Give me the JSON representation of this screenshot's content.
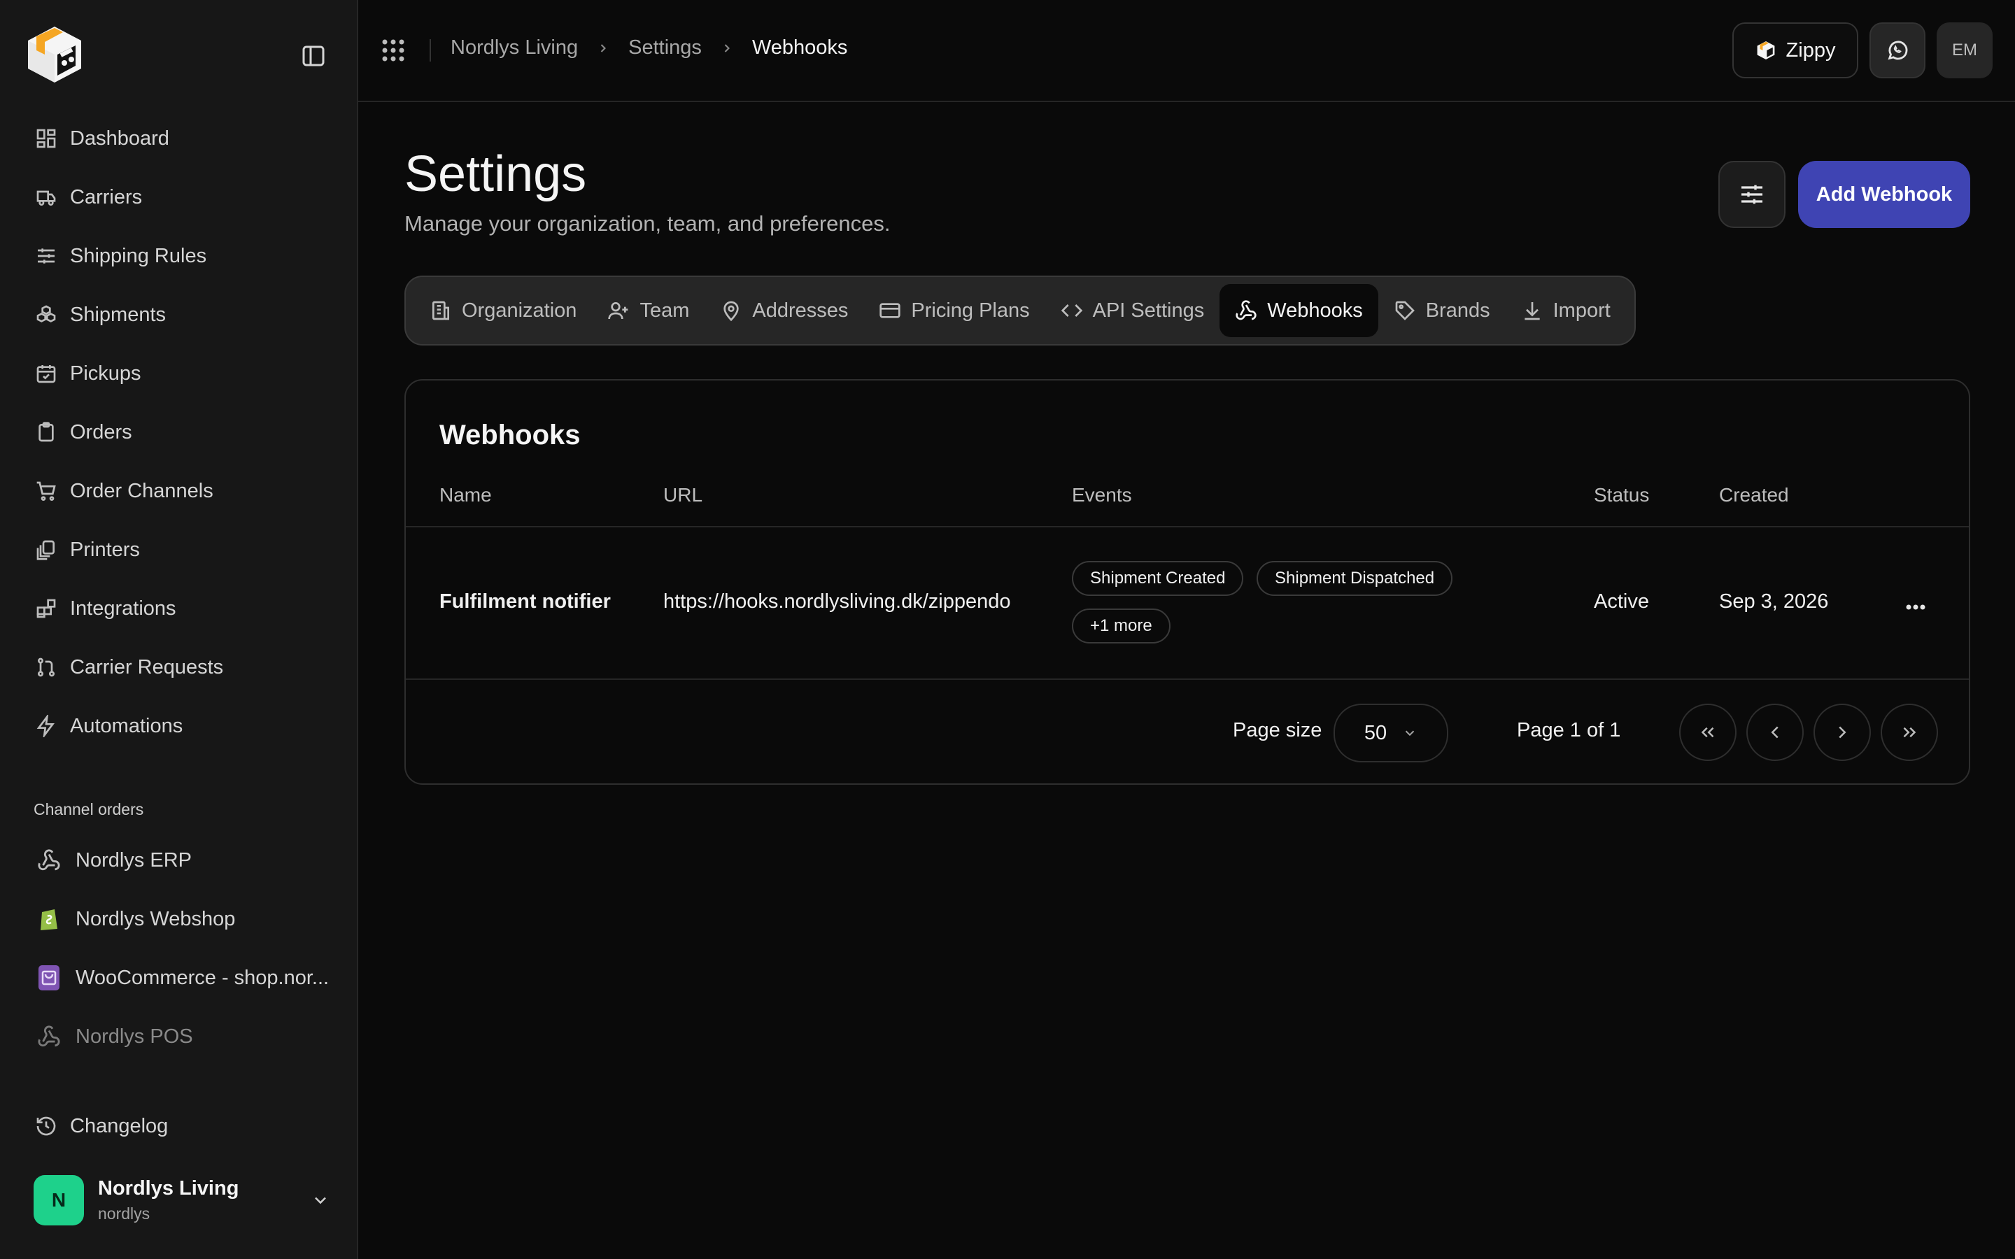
{
  "sidebar": {
    "nav": [
      {
        "label": "Dashboard",
        "icon": "dashboard-icon"
      },
      {
        "label": "Carriers",
        "icon": "truck-icon"
      },
      {
        "label": "Shipping Rules",
        "icon": "sliders-icon"
      },
      {
        "label": "Shipments",
        "icon": "boxes-icon"
      },
      {
        "label": "Pickups",
        "icon": "calendar-check-icon"
      },
      {
        "label": "Orders",
        "icon": "clipboard-icon"
      },
      {
        "label": "Order Channels",
        "icon": "cart-icon"
      },
      {
        "label": "Printers",
        "icon": "printer-icon"
      },
      {
        "label": "Integrations",
        "icon": "blocks-icon"
      },
      {
        "label": "Carrier Requests",
        "icon": "git-pull-icon"
      },
      {
        "label": "Automations",
        "icon": "zap-icon"
      }
    ],
    "channels_title": "Channel orders",
    "channels": [
      {
        "label": "Nordlys ERP",
        "icon": "webhook-icon"
      },
      {
        "label": "Nordlys Webshop",
        "icon": "shopify-icon"
      },
      {
        "label": "WooCommerce - shop.nor...",
        "icon": "woocommerce-icon"
      },
      {
        "label": "Nordlys POS",
        "icon": "webhook-icon"
      }
    ],
    "changelog": "Changelog",
    "org": {
      "initial": "N",
      "name": "Nordlys Living",
      "slug": "nordlys"
    }
  },
  "topbar": {
    "breadcrumb": [
      "Nordlys Living",
      "Settings",
      "Webhooks"
    ],
    "zippy_label": "Zippy",
    "user_initials": "EM"
  },
  "page": {
    "title": "Settings",
    "subtitle": "Manage your organization, team, and preferences.",
    "add_button": "Add Webhook"
  },
  "tabs": [
    {
      "label": "Organization",
      "icon": "building-icon"
    },
    {
      "label": "Team",
      "icon": "user-plus-icon"
    },
    {
      "label": "Addresses",
      "icon": "map-pin-icon"
    },
    {
      "label": "Pricing Plans",
      "icon": "credit-card-icon"
    },
    {
      "label": "API Settings",
      "icon": "code-icon"
    },
    {
      "label": "Webhooks",
      "icon": "webhook-icon",
      "active": true
    },
    {
      "label": "Brands",
      "icon": "tag-icon"
    },
    {
      "label": "Import",
      "icon": "download-icon"
    }
  ],
  "table": {
    "title": "Webhooks",
    "columns": [
      "Name",
      "URL",
      "Events",
      "Status",
      "Created"
    ],
    "rows": [
      {
        "name": "Fulfilment notifier",
        "url": "https://hooks.nordlysliving.dk/zippendo",
        "events": [
          "Shipment Created",
          "Shipment Dispatched"
        ],
        "more": "+1 more",
        "status": "Active",
        "created": "Sep 3, 2026"
      }
    ]
  },
  "pagination": {
    "page_size_label": "Page size",
    "page_size": "50",
    "page_info": "Page 1 of 1"
  },
  "colors": {
    "accent": "#3f44b3",
    "org_avatar": "#1ed18b",
    "background": "#0a0a0a",
    "sidebar": "#171717"
  }
}
